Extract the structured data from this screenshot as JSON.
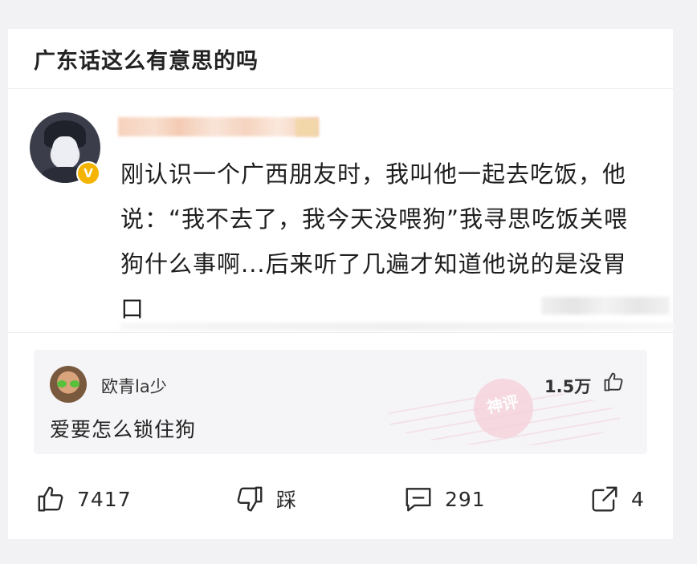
{
  "post": {
    "title": "广东话这么有意思的吗",
    "content": "刚认识一个广西朋友时，我叫他一起去吃饭，他说：“我不去了，我今天没喂狗”我寻思吃饭关喂狗什么事啊...后来听了几遍才知道他说的是没胃口"
  },
  "top_comment": {
    "username": "欧青la少",
    "likes": "1.5万",
    "text": "爱要怎么锁住狗",
    "stamp_text": "神评"
  },
  "actions": {
    "like_count": "7417",
    "dislike_label": "踩",
    "comment_count": "291",
    "share_count": "4"
  },
  "icons": {
    "avatar_badge": "verified-badge-icon",
    "like": "thumbs-up-icon",
    "dislike": "thumbs-down-icon",
    "comment": "comment-bubble-icon",
    "share": "share-icon"
  },
  "colors": {
    "background": "#f2f2f4",
    "card": "#ffffff",
    "comment_box": "#f5f5f7",
    "badge": "#f4b400",
    "stamp": "#f6d3dc"
  }
}
